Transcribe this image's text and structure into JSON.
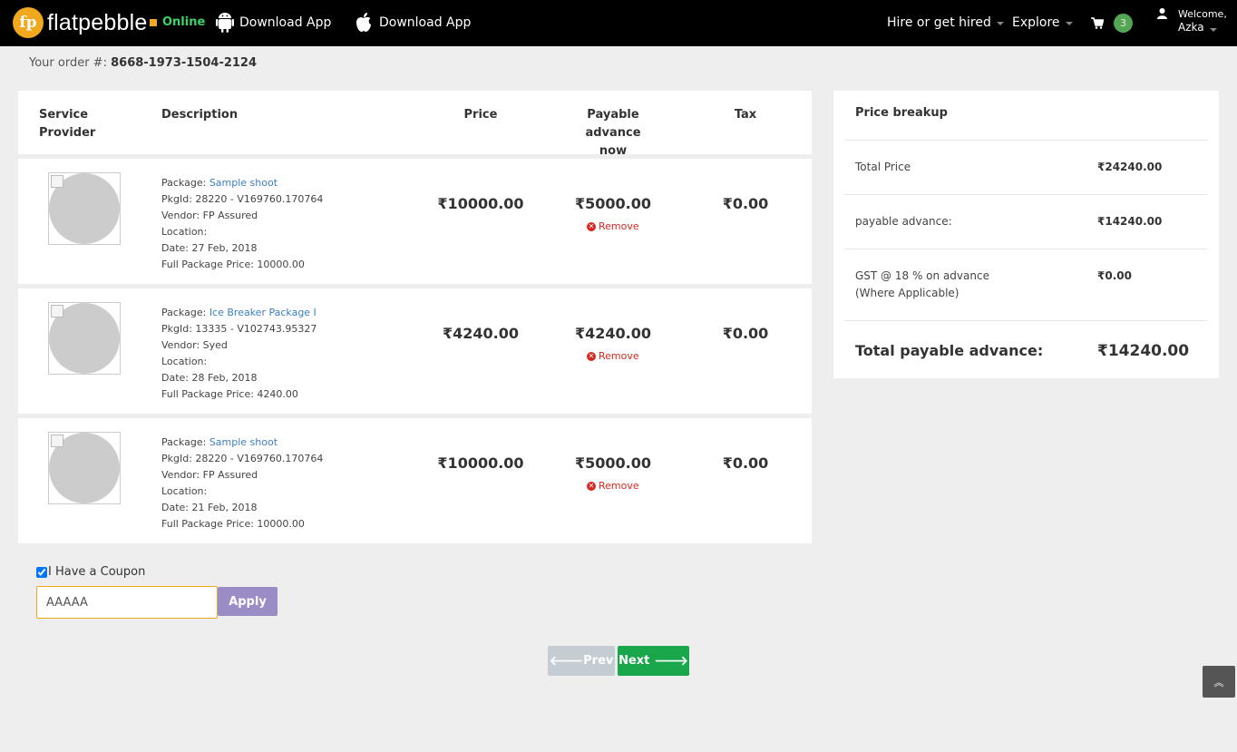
{
  "brand": {
    "name": "flatpebble",
    "logo_initials": "fp",
    "status": "Online"
  },
  "nav": {
    "android_download": "Download App",
    "ios_download": "Download App",
    "hire": "Hire or get hired",
    "explore": "Explore",
    "cart_count": "3",
    "welcome": "Welcome,",
    "user_name": "Azka"
  },
  "order": {
    "label": "Your order #:",
    "number": "8668-1973-1504-2124"
  },
  "table": {
    "headers": {
      "provider": "Service Provider",
      "description": "Description",
      "price": "Price",
      "advance_1": "Payable advance",
      "advance_2": "now",
      "tax": "Tax"
    },
    "rows": [
      {
        "package_label": "Package:",
        "package": "Sample shoot",
        "pkgid": "PkgId: 28220 - V169760.170764",
        "vendor": "Vendor: FP Assured",
        "location": "Location:",
        "date": "Date: 27 Feb, 2018",
        "full_price": "Full Package Price: 10000.00",
        "price": "₹10000.00",
        "advance": "₹5000.00",
        "remove": "Remove",
        "tax": "₹0.00"
      },
      {
        "package_label": "Package:",
        "package": "Ice Breaker Package I",
        "pkgid": "PkgId: 13335 - V102743.95327",
        "vendor": "Vendor: Syed",
        "location": "Location:",
        "date": "Date: 28 Feb, 2018",
        "full_price": "Full Package Price: 4240.00",
        "price": "₹4240.00",
        "advance": "₹4240.00",
        "remove": "Remove",
        "tax": "₹0.00"
      },
      {
        "package_label": "Package:",
        "package": "Sample shoot",
        "pkgid": "PkgId: 28220 - V169760.170764",
        "vendor": "Vendor: FP Assured",
        "location": "Location:",
        "date": "Date: 21 Feb, 2018",
        "full_price": "Full Package Price: 10000.00",
        "price": "₹10000.00",
        "advance": "₹5000.00",
        "remove": "Remove",
        "tax": "₹0.00"
      }
    ]
  },
  "breakup": {
    "title": "Price breakup",
    "total_price_label": "Total Price",
    "total_price": "₹24240.00",
    "advance_label": "payable advance:",
    "advance": "₹14240.00",
    "gst_label_1": "GST @ 18 % on advance",
    "gst_label_2": "(Where Applicable)",
    "gst": "₹0.00",
    "total_advance_label": "Total payable advance:",
    "total_advance": "₹14240.00"
  },
  "coupon": {
    "checkbox_label": "I Have a Coupon",
    "checked": true,
    "value": "AAAAA",
    "apply_label": "Apply"
  },
  "buttons": {
    "prev": "Prev",
    "next": "Next"
  },
  "colors": {
    "accent": "#f0a81f",
    "online": "#3bd36a",
    "next": "#1aa64a",
    "apply": "#9b8cc6",
    "remove": "#d9271f",
    "link": "#3a7ec2"
  }
}
